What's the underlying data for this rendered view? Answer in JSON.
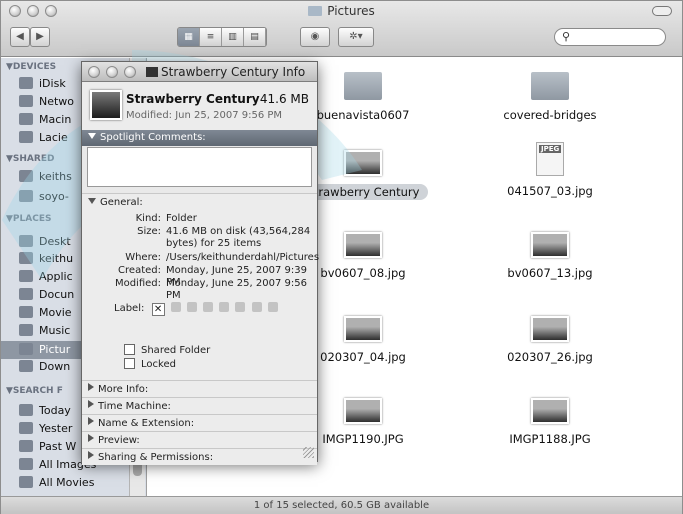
{
  "finder": {
    "title": "Pictures",
    "search_placeholder": "",
    "status": "1 of 15 selected, 60.5 GB available",
    "view_buttons": [
      "▦",
      "≡",
      "▥",
      "▤"
    ]
  },
  "sidebar": {
    "devices_label": "▼DEVICES",
    "devices": [
      "iDisk",
      "Netwo",
      "Macin",
      "Lacie"
    ],
    "shared_label": "▼SHARED",
    "shared": [
      "keiths",
      "soyo-"
    ],
    "places_label": "▼PLACES",
    "places": [
      "Deskt",
      "keithu",
      "Applic",
      "Docun",
      "Movie",
      "Music",
      "Pictur",
      "Down"
    ],
    "search_label": "▼SEARCH F",
    "search": [
      "Today",
      "Yester",
      "Past W",
      "All Images",
      "All Movies"
    ]
  },
  "files": [
    {
      "name": "buenavista0607",
      "kind": "folder"
    },
    {
      "name": "covered-bridges",
      "kind": "folder"
    },
    {
      "name": "Strawberry Century",
      "kind": "photo",
      "selected": true
    },
    {
      "name": "041507_03.jpg",
      "kind": "jpeg"
    },
    {
      "name": "bv0607_08.jpg",
      "kind": "photo"
    },
    {
      "name": "bv0607_13.jpg",
      "kind": "photo"
    },
    {
      "name": "020307_04.jpg",
      "kind": "photo"
    },
    {
      "name": "020307_26.jpg",
      "kind": "photo"
    },
    {
      "name": "IMGP1190.JPG",
      "kind": "photo"
    },
    {
      "name": "IMGP1188.JPG",
      "kind": "photo"
    }
  ],
  "jpeg_badge": "JPEG",
  "info": {
    "window_title": "Strawberry Century Info",
    "name": "Strawberry Century",
    "size": "41.6 MB",
    "modified_line": "Modified: Jun 25, 2007 9:56 PM",
    "spotlight_label": "Spotlight Comments:",
    "general_label": "General:",
    "kind_k": "Kind:",
    "kind_v": "Folder",
    "size_k": "Size:",
    "size_v": "41.6 MB on disk (43,564,284 bytes) for 25 items",
    "where_k": "Where:",
    "where_v": "/Users/keithunderdahl/Pictures",
    "created_k": "Created:",
    "created_v": "Monday, June 25, 2007 9:39 PM",
    "modified_k": "Modified:",
    "modified_v": "Monday, June 25, 2007 9:56 PM",
    "label_k": "Label:",
    "label_x": "✕",
    "shared_folder": "Shared Folder",
    "locked": "Locked",
    "sections": [
      "More Info:",
      "Time Machine:",
      "Name & Extension:",
      "Preview:",
      "Sharing & Permissions:"
    ]
  },
  "colors": {
    "watermark": "#9fd8e8",
    "sidebar_bg": "#d9dee6",
    "section_bar": "#6b7480"
  }
}
